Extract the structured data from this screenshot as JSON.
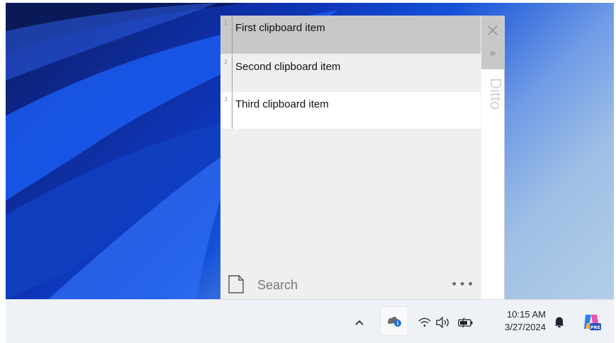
{
  "ditto": {
    "app_label": "Ditto",
    "close_glyph": "×",
    "expand_glyph": "»",
    "items": [
      {
        "number": "1",
        "text": "First clipboard item"
      },
      {
        "number": "2",
        "text": "Second clipboard item"
      },
      {
        "number": "3",
        "text": "Third clipboard item"
      }
    ],
    "search_placeholder": "Search",
    "more_glyph": "•••"
  },
  "taskbar": {
    "icons": [
      "chevron-up-icon",
      "onedrive-cloud-icon",
      "wifi-icon",
      "volume-icon",
      "battery-icon",
      "bell-icon",
      "copilot-icon"
    ],
    "time": "10:15 AM",
    "date": "3/27/2024",
    "copilot_badge": "PRE",
    "chevron_glyph": "^"
  },
  "colors": {
    "selected_item_bg": "#c8c8c8",
    "ditto_bg": "#efefef",
    "taskbar_bg": "#eef1f6"
  }
}
